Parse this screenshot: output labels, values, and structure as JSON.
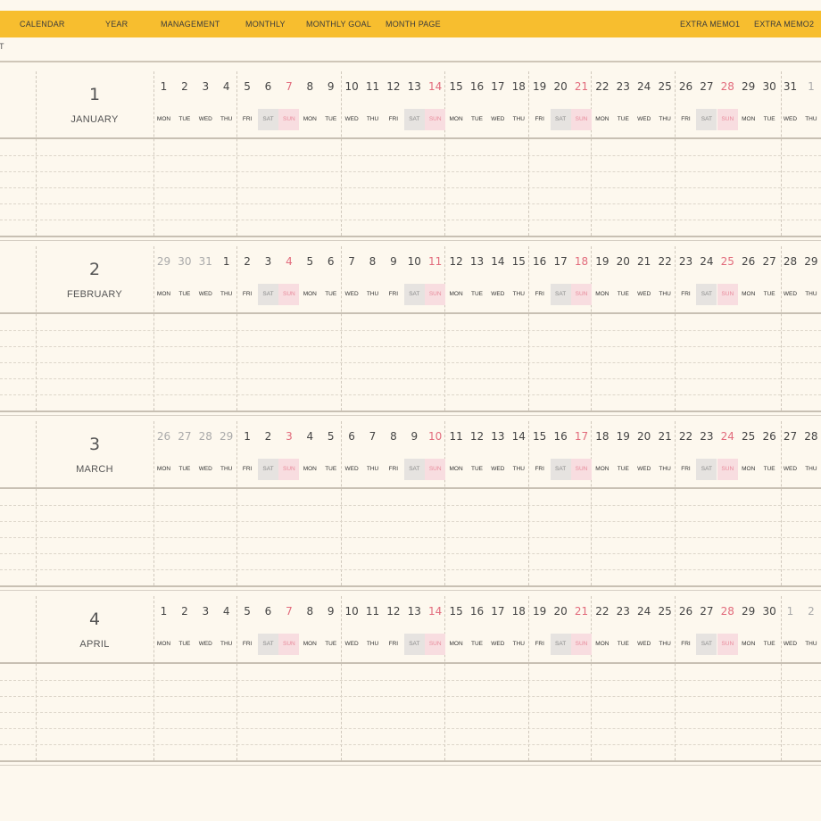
{
  "nav": {
    "items": [
      "CALENDAR",
      "YEAR",
      "MANAGEMENT",
      "MONTHLY",
      "MONTHLY GOAL",
      "MONTH PAGE",
      "EXTRA MEMO1",
      "EXTRA MEMO2"
    ]
  },
  "corner_text": "T",
  "colors": {
    "accent": "#f7be2f",
    "background": "#fdf8ee",
    "sunday": "#e26b7c",
    "saturday_fill": "#e6e3e0",
    "sunday_fill": "#f8dde0"
  },
  "months": [
    {
      "number": "1",
      "name": "JANUARY",
      "days": [
        "1",
        "2",
        "3",
        "4",
        "5",
        "6",
        "7",
        "8",
        "9",
        "10",
        "11",
        "12",
        "13",
        "14",
        "15",
        "16",
        "17",
        "18",
        "19",
        "20",
        "21",
        "22",
        "23",
        "24",
        "25",
        "26",
        "27",
        "28",
        "29",
        "30",
        "31",
        "1"
      ],
      "outside_days": [
        31
      ],
      "weekdays": [
        "MON",
        "TUE",
        "WED",
        "THU",
        "FRI",
        "SAT",
        "SUN",
        "MON",
        "TUE",
        "WED",
        "THU",
        "FRI",
        "SAT",
        "SUN",
        "MON",
        "TUE",
        "WED",
        "THU",
        "FRI",
        "SAT",
        "SUN",
        "MON",
        "TUE",
        "WED",
        "THU",
        "FRI",
        "SAT",
        "SUN",
        "MON",
        "TUE",
        "WED",
        "THU"
      ]
    },
    {
      "number": "2",
      "name": "FEBRUARY",
      "days": [
        "29",
        "30",
        "31",
        "1",
        "2",
        "3",
        "4",
        "5",
        "6",
        "7",
        "8",
        "9",
        "10",
        "11",
        "12",
        "13",
        "14",
        "15",
        "16",
        "17",
        "18",
        "19",
        "20",
        "21",
        "22",
        "23",
        "24",
        "25",
        "26",
        "27",
        "28",
        "29"
      ],
      "outside_days": [
        0,
        1,
        2
      ],
      "weekdays": [
        "MON",
        "TUE",
        "WED",
        "THU",
        "FRI",
        "SAT",
        "SUN",
        "MON",
        "TUE",
        "WED",
        "THU",
        "FRI",
        "SAT",
        "SUN",
        "MON",
        "TUE",
        "WED",
        "THU",
        "FRI",
        "SAT",
        "SUN",
        "MON",
        "TUE",
        "WED",
        "THU",
        "FRI",
        "SAT",
        "SUN",
        "MON",
        "TUE",
        "WED",
        "THU"
      ]
    },
    {
      "number": "3",
      "name": "MARCH",
      "days": [
        "26",
        "27",
        "28",
        "29",
        "1",
        "2",
        "3",
        "4",
        "5",
        "6",
        "7",
        "8",
        "9",
        "10",
        "11",
        "12",
        "13",
        "14",
        "15",
        "16",
        "17",
        "18",
        "19",
        "20",
        "21",
        "22",
        "23",
        "24",
        "25",
        "26",
        "27",
        "28"
      ],
      "outside_days": [
        0,
        1,
        2,
        3
      ],
      "weekdays": [
        "MON",
        "TUE",
        "WED",
        "THU",
        "FRI",
        "SAT",
        "SUN",
        "MON",
        "TUE",
        "WED",
        "THU",
        "FRI",
        "SAT",
        "SUN",
        "MON",
        "TUE",
        "WED",
        "THU",
        "FRI",
        "SAT",
        "SUN",
        "MON",
        "TUE",
        "WED",
        "THU",
        "FRI",
        "SAT",
        "SUN",
        "MON",
        "TUE",
        "WED",
        "THU"
      ]
    },
    {
      "number": "4",
      "name": "APRIL",
      "days": [
        "1",
        "2",
        "3",
        "4",
        "5",
        "6",
        "7",
        "8",
        "9",
        "10",
        "11",
        "12",
        "13",
        "14",
        "15",
        "16",
        "17",
        "18",
        "19",
        "20",
        "21",
        "22",
        "23",
        "24",
        "25",
        "26",
        "27",
        "28",
        "29",
        "30",
        "1",
        "2"
      ],
      "outside_days": [
        30,
        31
      ],
      "weekdays": [
        "MON",
        "TUE",
        "WED",
        "THU",
        "FRI",
        "SAT",
        "SUN",
        "MON",
        "TUE",
        "WED",
        "THU",
        "FRI",
        "SAT",
        "SUN",
        "MON",
        "TUE",
        "WED",
        "THU",
        "FRI",
        "SAT",
        "SUN",
        "MON",
        "TUE",
        "WED",
        "THU",
        "FRI",
        "SAT",
        "SUN",
        "MON",
        "TUE",
        "WED",
        "THU"
      ]
    }
  ]
}
